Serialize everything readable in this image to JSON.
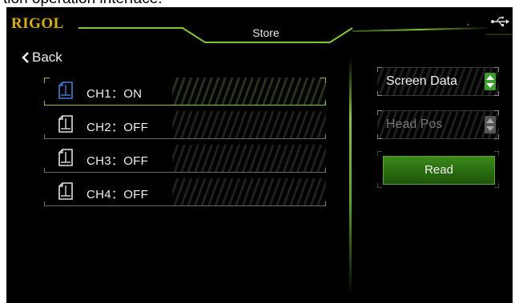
{
  "caption": "tion operation interface:",
  "header": {
    "brand": "RIGOL",
    "title": "Store",
    "status_icon": "usb-icon"
  },
  "nav": {
    "back_label": "Back",
    "back_icon": "chevron-left-icon"
  },
  "channels": [
    {
      "label": "CH1：ON",
      "icon": "document-icon",
      "selected": true
    },
    {
      "label": "CH2：OFF",
      "icon": "document-icon",
      "selected": false
    },
    {
      "label": "CH3：OFF",
      "icon": "document-icon",
      "selected": false
    },
    {
      "label": "CH4：OFF",
      "icon": "document-icon",
      "selected": false
    }
  ],
  "controls": {
    "data_type": {
      "value": "Screen Data",
      "enabled": true
    },
    "position": {
      "value": "Head Pos",
      "enabled": false
    },
    "read_label": "Read"
  },
  "colors": {
    "accent": "#7ec832",
    "brand": "#d9b100",
    "selected_icon": "#3d7fd8",
    "background": "#000000"
  }
}
